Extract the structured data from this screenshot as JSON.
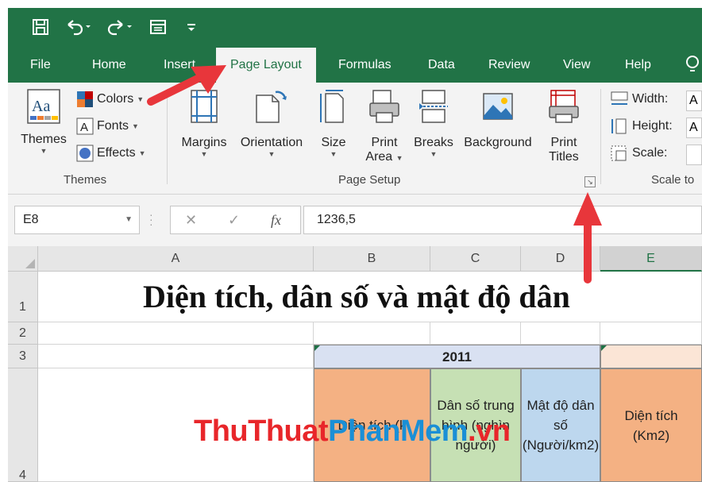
{
  "qat": {
    "icons": [
      "save-icon",
      "undo-icon",
      "redo-icon",
      "form-icon",
      "customize-icon"
    ]
  },
  "tabs": [
    {
      "label": "File"
    },
    {
      "label": "Home"
    },
    {
      "label": "Insert"
    },
    {
      "label": "Page Layout",
      "active": true
    },
    {
      "label": "Formulas"
    },
    {
      "label": "Data"
    },
    {
      "label": "Review"
    },
    {
      "label": "View"
    },
    {
      "label": "Help"
    }
  ],
  "ribbon": {
    "themes_group": {
      "themes_label": "Themes",
      "colors_label": "Colors",
      "fonts_label": "Fonts",
      "effects_label": "Effects",
      "group_label": "Themes"
    },
    "page_setup_group": {
      "margins_label": "Margins",
      "orientation_label": "Orientation",
      "size_label": "Size",
      "print_area_line1": "Print",
      "print_area_line2": "Area",
      "breaks_label": "Breaks",
      "background_label": "Background",
      "print_titles_line1": "Print",
      "print_titles_line2": "Titles",
      "group_label": "Page Setup"
    },
    "scale_group": {
      "width_label": "Width:",
      "height_label": "Height:",
      "scale_label": "Scale:",
      "width_value": "A",
      "height_value": "A",
      "group_label": "Scale to"
    }
  },
  "formula_bar": {
    "name_box": "E8",
    "cancel": "✕",
    "enter": "✓",
    "fx": "fx",
    "formula": "1236,5"
  },
  "grid": {
    "columns": [
      "A",
      "B",
      "C",
      "D",
      "E"
    ],
    "rows": [
      "1",
      "2",
      "3",
      "4"
    ],
    "title": "Diện tích, dân số và mật độ dân",
    "year_2011": "2011",
    "hdr_b4": "Diện tích (k",
    "hdr_c4": "Dân số trung bình (nghìn người)",
    "hdr_d4": "Mật độ dân số (Người/km2)",
    "hdr_e4": "Diện tích (Km2)"
  },
  "watermark": {
    "part1": "ThuThuat",
    "part2": "PhanMem",
    "part3": ".vn"
  },
  "colors": {
    "excel_green": "#217346",
    "arrow_red": "#e8363b",
    "orange_fill": "#f4b183",
    "green_fill": "#c6e0b4",
    "blue_fill": "#bdd7ee",
    "blue_header": "#d9e1f2",
    "peach_fill": "#fbe5d6"
  }
}
